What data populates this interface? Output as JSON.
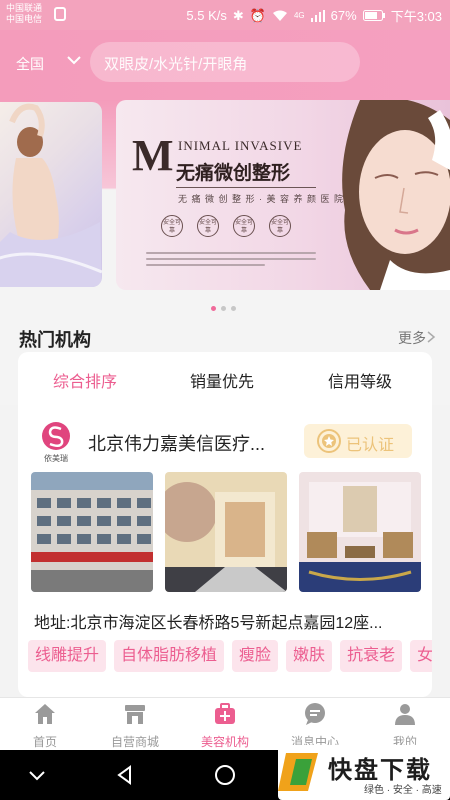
{
  "status_bar": {
    "carrier_1": "中国联通",
    "carrier_2": "中国电信",
    "speed": "5.5 K/s",
    "signal_4g": "4G",
    "battery": "67%",
    "time": "下午3:03"
  },
  "header": {
    "city": "全国",
    "search_placeholder": "双眼皮/水光针/开眼角"
  },
  "banner": {
    "title_letter": "M",
    "title_en": "INIMAL INVASIVE",
    "title_cn": "无痛微创整形",
    "subtitle": "无 痛 微 创 整 形 · 美 容 养 颜 医 院",
    "badges": [
      "安全可靠",
      "安全可靠",
      "安全可靠",
      "安全可靠"
    ],
    "pages": 3,
    "active_page": 1
  },
  "section": {
    "title": "热门机构",
    "more": "更多"
  },
  "tabs": [
    {
      "label": "综合排序",
      "active": true
    },
    {
      "label": "销量优先",
      "active": false
    },
    {
      "label": "信用等级",
      "active": false
    }
  ],
  "institution": {
    "logo_text": "依美瑞",
    "name": "北京伟力嘉美信医疗...",
    "verified": "已认证",
    "address": "地址:北京市海淀区长春桥路5号新起点嘉园12座...",
    "tags": [
      "线雕提升",
      "自体脂肪移植",
      "瘦脸",
      "嫩肤",
      "抗衰老",
      "女"
    ]
  },
  "bottom_nav": [
    {
      "label": "首页",
      "icon": "home-icon",
      "active": false
    },
    {
      "label": "自营商城",
      "icon": "store-icon",
      "active": false
    },
    {
      "label": "美容机构",
      "icon": "medical-kit-icon",
      "active": true
    },
    {
      "label": "消息中心",
      "icon": "message-icon",
      "active": false
    },
    {
      "label": "我的",
      "icon": "profile-icon",
      "active": false
    }
  ],
  "watermark": {
    "brand": "快盘下载",
    "slogan": "绿色 · 安全 · 高速"
  },
  "colors": {
    "brand_pink": "#f49cbb",
    "accent": "#ec5e90",
    "tag_bg": "#fce4ec",
    "verified_gold": "#ecc37a"
  }
}
